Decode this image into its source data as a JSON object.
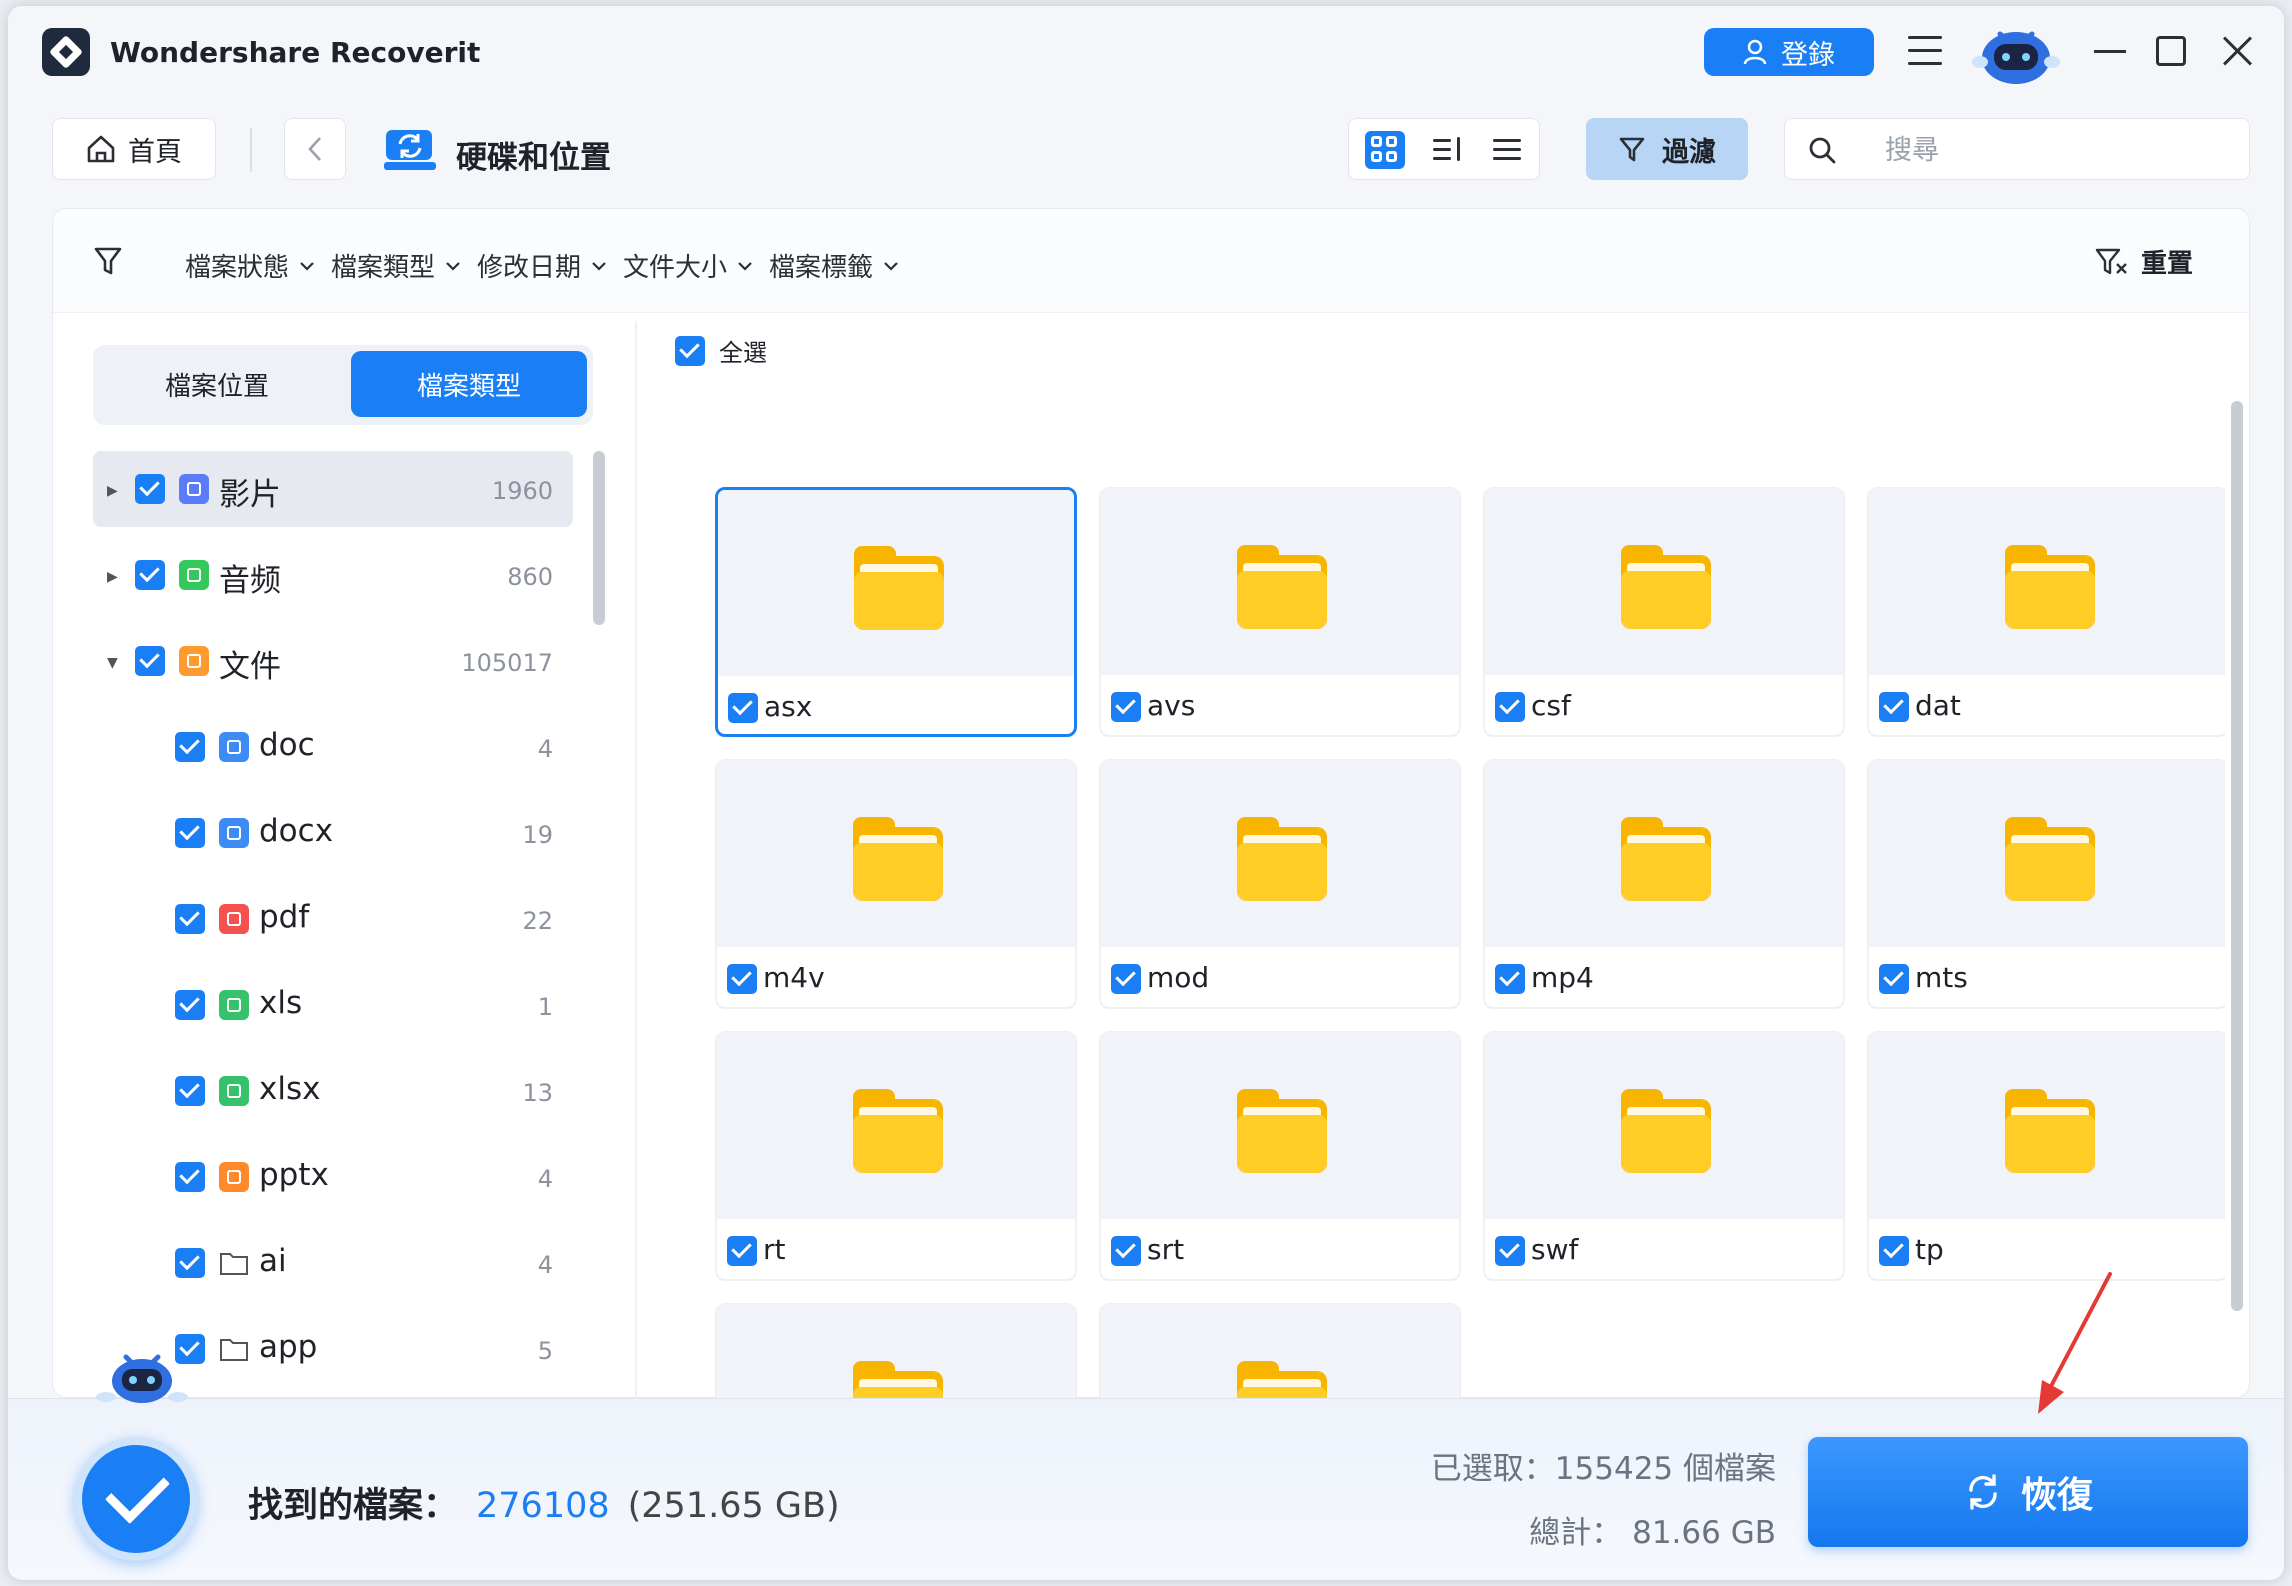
{
  "app": {
    "title": "Wondershare Recoverit"
  },
  "header": {
    "login_label": "登錄",
    "home_label": "首頁",
    "location_title": "硬碟和位置",
    "filter_label": "過濾",
    "search_placeholder": "搜尋"
  },
  "filters": {
    "items": [
      "檔案狀態",
      "檔案類型",
      "修改日期",
      "文件大小",
      "檔案標籤"
    ],
    "reset_label": "重置"
  },
  "sidebar": {
    "tabs": [
      "檔案位置",
      "檔案類型"
    ],
    "active_tab": "檔案類型",
    "tree": [
      {
        "label": "影片",
        "count": "1960",
        "icon": "video-icon",
        "color": "#5b7cfa",
        "expanded": false,
        "level": 0
      },
      {
        "label": "音频",
        "count": "860",
        "icon": "music-icon",
        "color": "#34c759",
        "expanded": false,
        "level": 0
      },
      {
        "label": "文件",
        "count": "105017",
        "icon": "document-icon",
        "color": "#ff9a2e",
        "expanded": true,
        "level": 0
      },
      {
        "label": "doc",
        "count": "4",
        "icon": "word-icon",
        "color": "#3d8cf6",
        "level": 1
      },
      {
        "label": "docx",
        "count": "19",
        "icon": "word-icon",
        "color": "#3d8cf6",
        "level": 1
      },
      {
        "label": "pdf",
        "count": "22",
        "icon": "pdf-icon",
        "color": "#f5514f",
        "level": 1
      },
      {
        "label": "xls",
        "count": "1",
        "icon": "excel-icon",
        "color": "#36c26a",
        "level": 1
      },
      {
        "label": "xlsx",
        "count": "13",
        "icon": "excel-icon",
        "color": "#36c26a",
        "level": 1
      },
      {
        "label": "pptx",
        "count": "4",
        "icon": "powerpoint-icon",
        "color": "#ff8a2b",
        "level": 1
      },
      {
        "label": "ai",
        "count": "4",
        "icon": "folder-outline-icon",
        "color": "#555555",
        "level": 1
      },
      {
        "label": "app",
        "count": "5",
        "icon": "folder-outline-icon",
        "color": "#555555",
        "level": 1
      }
    ]
  },
  "grid": {
    "select_all_label": "全選",
    "items": [
      "asx",
      "avs",
      "csf",
      "dat",
      "m4v",
      "mod",
      "mp4",
      "mts",
      "rt",
      "srt",
      "swf",
      "tp",
      "",
      ""
    ]
  },
  "footer": {
    "found_label": "找到的檔案：",
    "found_count": "276108",
    "found_size": "(251.65 GB)",
    "selected_text": "已選取：155425 個檔案",
    "total_text": "總計： 81.66 GB",
    "recover_label": "恢復"
  },
  "colors": {
    "accent": "#1a7ff5",
    "folder": "#ffcd26"
  }
}
